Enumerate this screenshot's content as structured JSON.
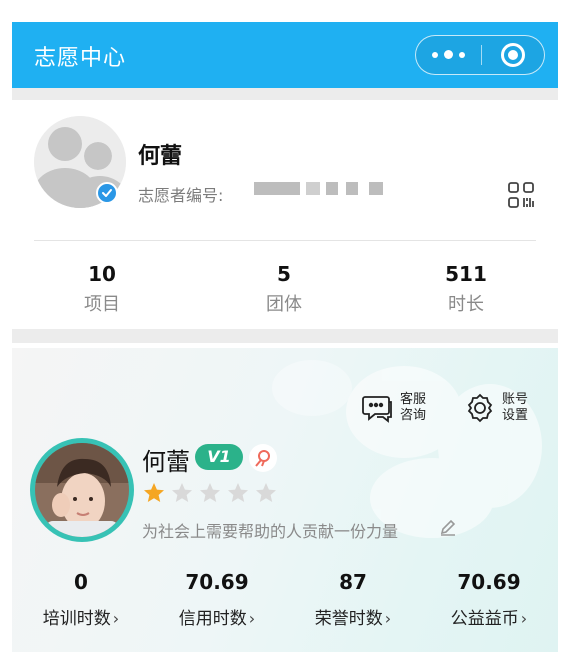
{
  "header": {
    "title": "志愿中心",
    "more_icon": "more-dots-icon",
    "close_icon": "target-close-icon",
    "color": "#1fb0f2"
  },
  "profile": {
    "name": "何蕾",
    "volunteer_no_label": "志愿者编号:",
    "avatar_icon": "default-avatar-icon",
    "verified_icon": "verified-check-icon",
    "qr_icon": "qr-code-icon"
  },
  "stats": [
    {
      "value": "10",
      "label": "项目"
    },
    {
      "value": "5",
      "label": "团体"
    },
    {
      "value": "511",
      "label": "时长"
    }
  ],
  "card": {
    "service_label_1": "客服",
    "service_label_2": "咨询",
    "settings_label_1": "账号",
    "settings_label_2": "设置",
    "name": "何蕾",
    "level": "V1",
    "rating": 1,
    "rating_max": 5,
    "motto": "为社会上需要帮助的人贡献一份力量",
    "accent_color": "#2bb28a",
    "star_color": "#f5a623",
    "stats": [
      {
        "value": "0",
        "label": "培训时数"
      },
      {
        "value": "70.69",
        "label": "信用时数"
      },
      {
        "value": "87",
        "label": "荣誉时数"
      },
      {
        "value": "70.69",
        "label": "公益益币"
      }
    ]
  }
}
